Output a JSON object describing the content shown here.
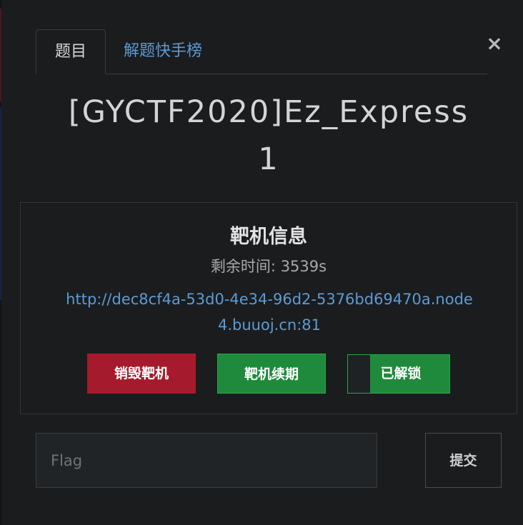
{
  "tabs": {
    "challenge_label": "题目",
    "leaderboard_label": "解题快手榜"
  },
  "close_icon": "close-icon",
  "challenge": {
    "title": "[GYCTF2020]Ez_Express",
    "points": "1"
  },
  "instance": {
    "heading": "靶机信息",
    "remaining_label": "剩余时间",
    "remaining_value": "3539s",
    "url": "http://dec8cf4a-53d0-4e34-96d2-5376bd69470a.node4.buuoj.cn:81"
  },
  "buttons": {
    "destroy_label": "销毁靶机",
    "renew_label": "靶机续期",
    "unlocked_label": "已解锁"
  },
  "flag": {
    "placeholder": "Flag",
    "value": "",
    "submit_label": "提交"
  },
  "colors": {
    "background": "#1b1c1e",
    "link": "#5b9bd5",
    "danger": "#a51b2d",
    "success": "#1f8a3b"
  }
}
